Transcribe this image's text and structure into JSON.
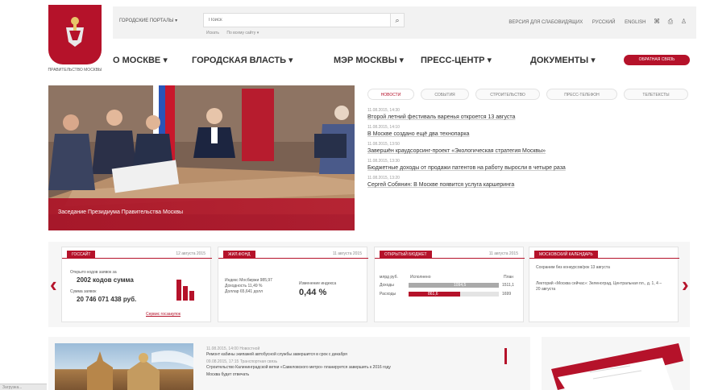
{
  "header": {
    "logo_caption": "ПРАВИТЕЛЬСТВО МОСКВЫ",
    "portals_label": "ГОРОДСКИЕ ПОРТАЛЫ ▾",
    "search_placeholder": "Поиск",
    "search_links": [
      "Искать",
      "По всему сайту ▾"
    ],
    "version_link": "ВЕРСИЯ ДЛЯ СЛАБОВИДЯЩИХ",
    "lang_ru": "РУССКИЙ",
    "lang_en": "ENGLISH",
    "icons": [
      "rss-icon",
      "print-icon",
      "user-icon"
    ]
  },
  "nav": {
    "items": [
      "О МОСКВЕ ▾",
      "ГОРОДСКАЯ ВЛАСТЬ ▾",
      "МЭР МОСКВЫ ▾",
      "ПРЕСС-ЦЕНТР ▾",
      "ДОКУМЕНТЫ ▾"
    ],
    "cta": "ОБРАТНАЯ СВЯЗЬ"
  },
  "hero": {
    "caption": "Заседание Президиума Правительства Москвы"
  },
  "news": {
    "tabs": [
      "НОВОСТИ",
      "СОБЫТИЯ",
      "СТРОИТЕЛЬСТВО",
      "ПРЕСС-ТЕЛЕФОН",
      "ТЕЛЕТЕКСТЫ"
    ],
    "items": [
      {
        "date": "11.08.2015, 14:30",
        "title": "Второй летний фестиваль варенья откроется 13 августа"
      },
      {
        "date": "11.08.2015, 14:10",
        "title": "В Москве создано ещё два технопарка"
      },
      {
        "date": "11.08.2015, 13:50",
        "title": "Завершён краудсорсинг-проект «Экологическая стратегия Москвы»"
      },
      {
        "date": "11.08.2015, 13:30",
        "title": "Бюджетные доходы от продажи патентов на работу выросли в четыре раза"
      },
      {
        "date": "11.08.2015, 13:20",
        "title": "Сергей Собянин: В Москве появится услуга каршеринга"
      }
    ]
  },
  "widgets": {
    "stats": {
      "tag": "ГОССАЙТ",
      "date": "12 августа 2015",
      "line1": "Открыто кодов заявок за",
      "big1": "2002 кодов сумма",
      "line2": "Сумма заявок",
      "big2": "20 746 071 438 руб.",
      "link": "Сервис госзакупок"
    },
    "market": {
      "tag": "ЖИЛ.ФОНД",
      "date": "11 августа 2015",
      "lines": [
        "Индекс Мосбиржи 985,97",
        "Доходность 11,49 %",
        "Доллар 65,641 долл"
      ],
      "mid": "Изменение индекса",
      "big": "0,44 %"
    },
    "budget": {
      "tag": "ОТКРЫТЫЙ БЮДЖЕТ",
      "date": "11 августа 2015",
      "head_left": "млрд руб.",
      "head_mid": "Исполнено",
      "head_right": "План",
      "rows": [
        {
          "label": "Доходы",
          "value": "1094,5",
          "plan": "1511,1"
        },
        {
          "label": "Расходы",
          "value": "861,6",
          "plan": "1699"
        }
      ]
    },
    "events": {
      "tag": "МОСКОВСКИЙ КАЛЕНДАРЬ",
      "items": [
        "Сохраним без конкурсов/рок 13 августа",
        "Лекторий «Москва сейчас»: Зеленоград, Центральная пл., д. 1, 4 – 20 августа"
      ]
    }
  },
  "bottom": {
    "news": [
      {
        "date": "11.08.2015, 14:00",
        "tag": "Новостной",
        "text": "Ремонт кабины экипажей автобусной службы завершится в срок с декабря"
      },
      {
        "date": "09.08.2015, 17:15",
        "tag": "Транспортная связь",
        "text": "Строительство Калининградской ветки «Савеловского метро» планируется завершить к 2016 году"
      },
      {
        "date": "",
        "tag": "",
        "text": "Москва будет отвечать"
      }
    ]
  },
  "status_text": "Загрузка..."
}
